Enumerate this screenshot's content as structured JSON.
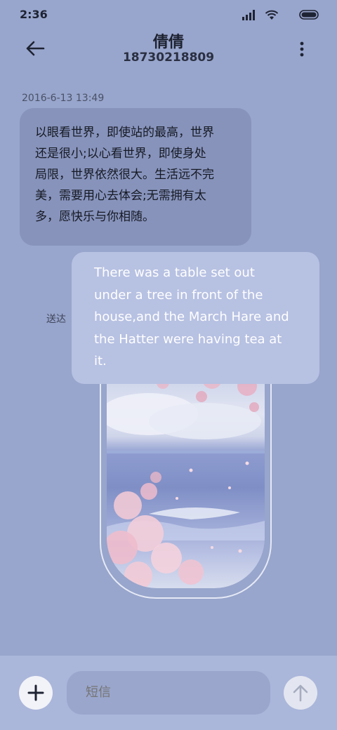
{
  "status_bar": {
    "time": "2:36",
    "icons": [
      "signal-icon",
      "wifi-icon",
      "battery-icon"
    ]
  },
  "header": {
    "contact_name": "倩倩",
    "contact_number": "18730218809",
    "icons": [
      "back-arrow-icon",
      "more-vertical-icon"
    ]
  },
  "conversation": {
    "timestamp": "2016-6-13 13:49",
    "incoming_lines": [
      "以眼看世界，即使站的最高，世界",
      "还是很小;以心看世界，即使身处",
      "局限，世界依然很大。生活远不完",
      "美，需要用心去体会;无需拥有太",
      "多，愿快乐与你相随。"
    ],
    "outgoing_lines": [
      "There was a table set out",
      "under a tree in front of the",
      "house,and the March Hare and",
      "the Hatter were having tea at",
      "it."
    ],
    "delivery_status": "送达"
  },
  "compose": {
    "placeholder": "短信",
    "icons": [
      "plus-icon",
      "send-arrow-icon"
    ]
  },
  "colors": {
    "background": "#98a5cc",
    "incoming_bubble": "#8793bb",
    "outgoing_bubble": "#b7c1e2",
    "compose_bar": "#aab6da"
  }
}
